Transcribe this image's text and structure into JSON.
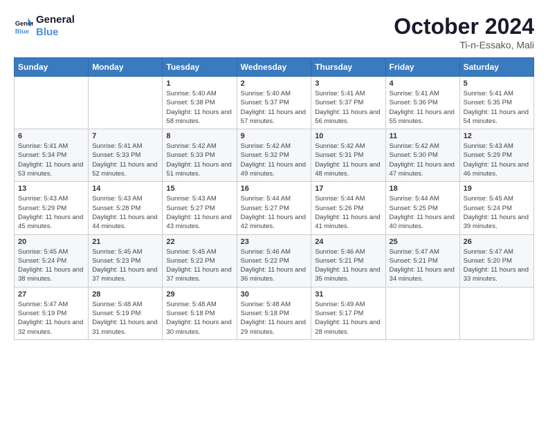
{
  "logo": {
    "line1": "General",
    "line2": "Blue"
  },
  "title": {
    "month_year": "October 2024",
    "location": "Ti-n-Essako, Mali"
  },
  "weekdays": [
    "Sunday",
    "Monday",
    "Tuesday",
    "Wednesday",
    "Thursday",
    "Friday",
    "Saturday"
  ],
  "weeks": [
    [
      {
        "day": "",
        "info": ""
      },
      {
        "day": "",
        "info": ""
      },
      {
        "day": "1",
        "info": "Sunrise: 5:40 AM\nSunset: 5:38 PM\nDaylight: 11 hours and 58 minutes."
      },
      {
        "day": "2",
        "info": "Sunrise: 5:40 AM\nSunset: 5:37 PM\nDaylight: 11 hours and 57 minutes."
      },
      {
        "day": "3",
        "info": "Sunrise: 5:41 AM\nSunset: 5:37 PM\nDaylight: 11 hours and 56 minutes."
      },
      {
        "day": "4",
        "info": "Sunrise: 5:41 AM\nSunset: 5:36 PM\nDaylight: 11 hours and 55 minutes."
      },
      {
        "day": "5",
        "info": "Sunrise: 5:41 AM\nSunset: 5:35 PM\nDaylight: 11 hours and 54 minutes."
      }
    ],
    [
      {
        "day": "6",
        "info": "Sunrise: 5:41 AM\nSunset: 5:34 PM\nDaylight: 11 hours and 53 minutes."
      },
      {
        "day": "7",
        "info": "Sunrise: 5:41 AM\nSunset: 5:33 PM\nDaylight: 11 hours and 52 minutes."
      },
      {
        "day": "8",
        "info": "Sunrise: 5:42 AM\nSunset: 5:33 PM\nDaylight: 11 hours and 51 minutes."
      },
      {
        "day": "9",
        "info": "Sunrise: 5:42 AM\nSunset: 5:32 PM\nDaylight: 11 hours and 49 minutes."
      },
      {
        "day": "10",
        "info": "Sunrise: 5:42 AM\nSunset: 5:31 PM\nDaylight: 11 hours and 48 minutes."
      },
      {
        "day": "11",
        "info": "Sunrise: 5:42 AM\nSunset: 5:30 PM\nDaylight: 11 hours and 47 minutes."
      },
      {
        "day": "12",
        "info": "Sunrise: 5:43 AM\nSunset: 5:29 PM\nDaylight: 11 hours and 46 minutes."
      }
    ],
    [
      {
        "day": "13",
        "info": "Sunrise: 5:43 AM\nSunset: 5:29 PM\nDaylight: 11 hours and 45 minutes."
      },
      {
        "day": "14",
        "info": "Sunrise: 5:43 AM\nSunset: 5:28 PM\nDaylight: 11 hours and 44 minutes."
      },
      {
        "day": "15",
        "info": "Sunrise: 5:43 AM\nSunset: 5:27 PM\nDaylight: 11 hours and 43 minutes."
      },
      {
        "day": "16",
        "info": "Sunrise: 5:44 AM\nSunset: 5:27 PM\nDaylight: 11 hours and 42 minutes."
      },
      {
        "day": "17",
        "info": "Sunrise: 5:44 AM\nSunset: 5:26 PM\nDaylight: 11 hours and 41 minutes."
      },
      {
        "day": "18",
        "info": "Sunrise: 5:44 AM\nSunset: 5:25 PM\nDaylight: 11 hours and 40 minutes."
      },
      {
        "day": "19",
        "info": "Sunrise: 5:45 AM\nSunset: 5:24 PM\nDaylight: 11 hours and 39 minutes."
      }
    ],
    [
      {
        "day": "20",
        "info": "Sunrise: 5:45 AM\nSunset: 5:24 PM\nDaylight: 11 hours and 38 minutes."
      },
      {
        "day": "21",
        "info": "Sunrise: 5:45 AM\nSunset: 5:23 PM\nDaylight: 11 hours and 37 minutes."
      },
      {
        "day": "22",
        "info": "Sunrise: 5:45 AM\nSunset: 5:22 PM\nDaylight: 11 hours and 37 minutes."
      },
      {
        "day": "23",
        "info": "Sunrise: 5:46 AM\nSunset: 5:22 PM\nDaylight: 11 hours and 36 minutes."
      },
      {
        "day": "24",
        "info": "Sunrise: 5:46 AM\nSunset: 5:21 PM\nDaylight: 11 hours and 35 minutes."
      },
      {
        "day": "25",
        "info": "Sunrise: 5:47 AM\nSunset: 5:21 PM\nDaylight: 11 hours and 34 minutes."
      },
      {
        "day": "26",
        "info": "Sunrise: 5:47 AM\nSunset: 5:20 PM\nDaylight: 11 hours and 33 minutes."
      }
    ],
    [
      {
        "day": "27",
        "info": "Sunrise: 5:47 AM\nSunset: 5:19 PM\nDaylight: 11 hours and 32 minutes."
      },
      {
        "day": "28",
        "info": "Sunrise: 5:48 AM\nSunset: 5:19 PM\nDaylight: 11 hours and 31 minutes."
      },
      {
        "day": "29",
        "info": "Sunrise: 5:48 AM\nSunset: 5:18 PM\nDaylight: 11 hours and 30 minutes."
      },
      {
        "day": "30",
        "info": "Sunrise: 5:48 AM\nSunset: 5:18 PM\nDaylight: 11 hours and 29 minutes."
      },
      {
        "day": "31",
        "info": "Sunrise: 5:49 AM\nSunset: 5:17 PM\nDaylight: 11 hours and 28 minutes."
      },
      {
        "day": "",
        "info": ""
      },
      {
        "day": "",
        "info": ""
      }
    ]
  ]
}
